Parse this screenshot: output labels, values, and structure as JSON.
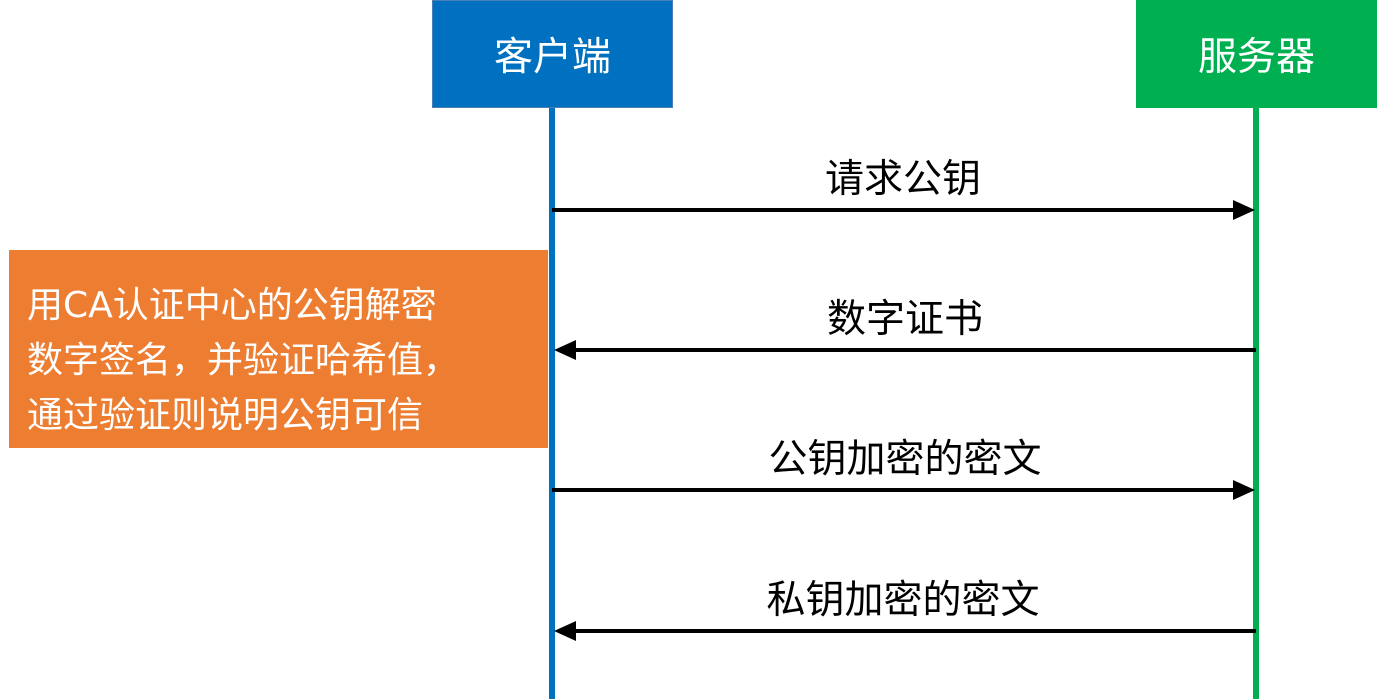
{
  "colors": {
    "client": "#0070c0",
    "server": "#00b050",
    "note": "#ed7d31",
    "arrow": "#000000"
  },
  "participants": {
    "client": {
      "label": "客户端"
    },
    "server": {
      "label": "服务器"
    }
  },
  "messages": [
    {
      "label": "请求公钥",
      "direction": "client-to-server"
    },
    {
      "label": "数字证书",
      "direction": "server-to-client"
    },
    {
      "label": "公钥加密的密文",
      "direction": "client-to-server"
    },
    {
      "label": "私钥加密的密文",
      "direction": "server-to-client"
    }
  ],
  "note": {
    "lines": [
      "用CA认证中心的公钥解密",
      "数字签名，并验证哈希值，",
      "通过验证则说明公钥可信"
    ]
  }
}
